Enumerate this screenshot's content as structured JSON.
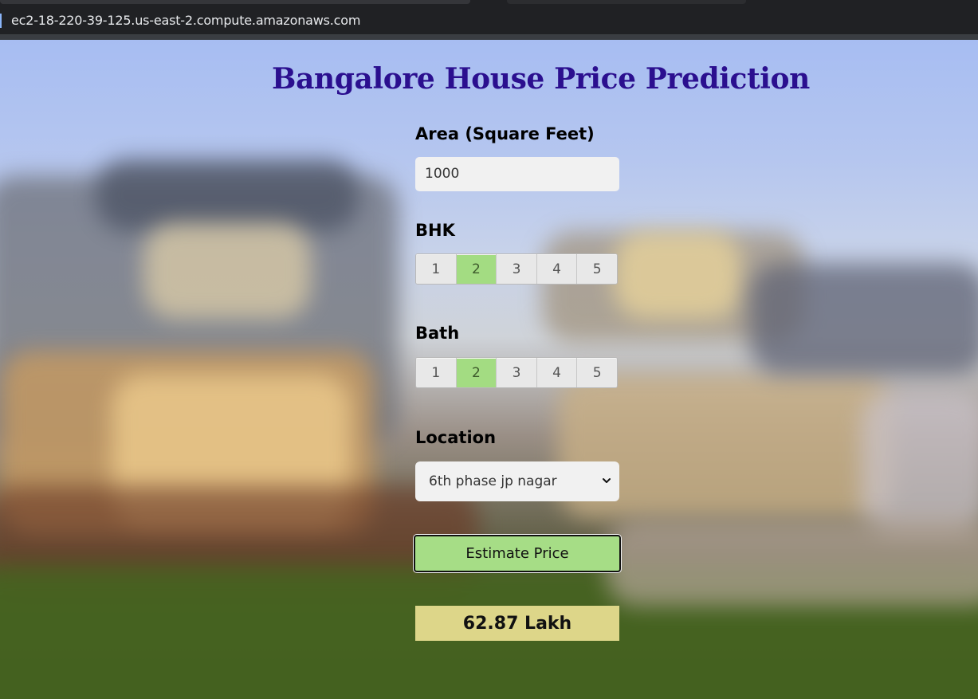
{
  "browser": {
    "url": "ec2-18-220-39-125.us-east-2.compute.amazonaws.com"
  },
  "page": {
    "title": "Bangalore House Price Prediction",
    "area": {
      "label": "Area (Square Feet)",
      "value": "1000"
    },
    "bhk": {
      "label": "BHK",
      "options": [
        "1",
        "2",
        "3",
        "4",
        "5"
      ],
      "selected": "2"
    },
    "bath": {
      "label": "Bath",
      "options": [
        "1",
        "2",
        "3",
        "4",
        "5"
      ],
      "selected": "2"
    },
    "location": {
      "label": "Location",
      "selected": "6th phase jp nagar"
    },
    "estimate_button": "Estimate Price",
    "result": "62.87 Lakh"
  },
  "colors": {
    "title": "#2b0f8f",
    "selected_option": "#a3dc82",
    "button": "#a6dd86",
    "result_bg": "#ddd689"
  },
  "icons": {
    "select_arrow": "chevron-down-icon"
  }
}
